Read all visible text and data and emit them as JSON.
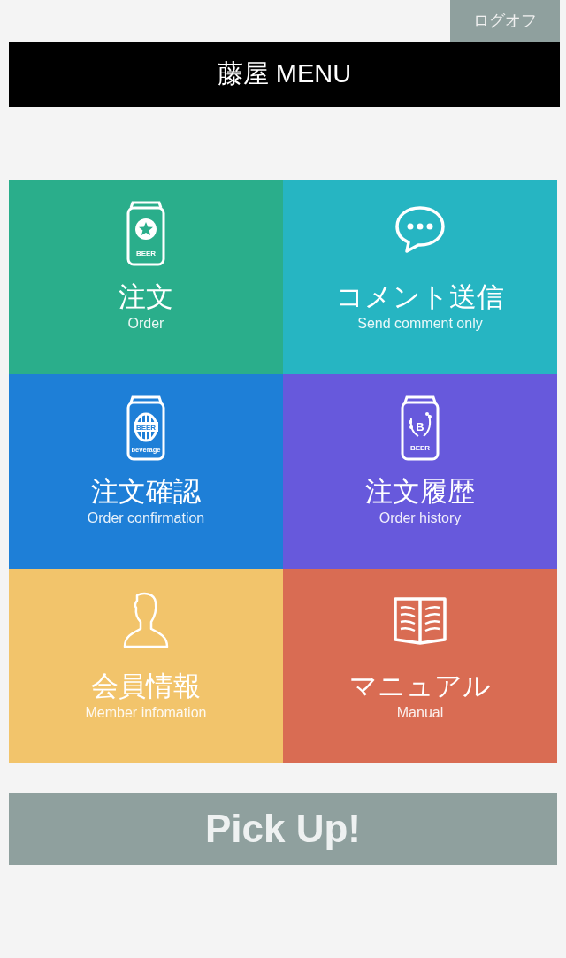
{
  "logoff_button": "ログオフ",
  "header": {
    "title": "藤屋 MENU"
  },
  "tiles": [
    {
      "kind": "beer-star",
      "icon_texts": [
        "BEER"
      ],
      "title": "注文",
      "subtitle": "Order",
      "color": "#2aae8b"
    },
    {
      "kind": "chat",
      "title": "コメント送信",
      "subtitle": "Send comment only",
      "color": "#26b5c2"
    },
    {
      "kind": "beer-beverage",
      "icon_texts": [
        "BEER",
        "beverage"
      ],
      "title": "注文確認",
      "subtitle": "Order confirmation",
      "color": "#1e7fd7"
    },
    {
      "kind": "beer-wheat",
      "icon_texts": [
        "B",
        "BEER"
      ],
      "title": "注文履歴",
      "subtitle": "Order history",
      "color": "#6759dc"
    },
    {
      "kind": "person",
      "title": "会員情報",
      "subtitle": "Member infomation",
      "color": "#f2c46b"
    },
    {
      "kind": "book",
      "title": "マニュアル",
      "subtitle": "Manual",
      "color": "#d96c53"
    }
  ],
  "pickup_button": "Pick Up!"
}
